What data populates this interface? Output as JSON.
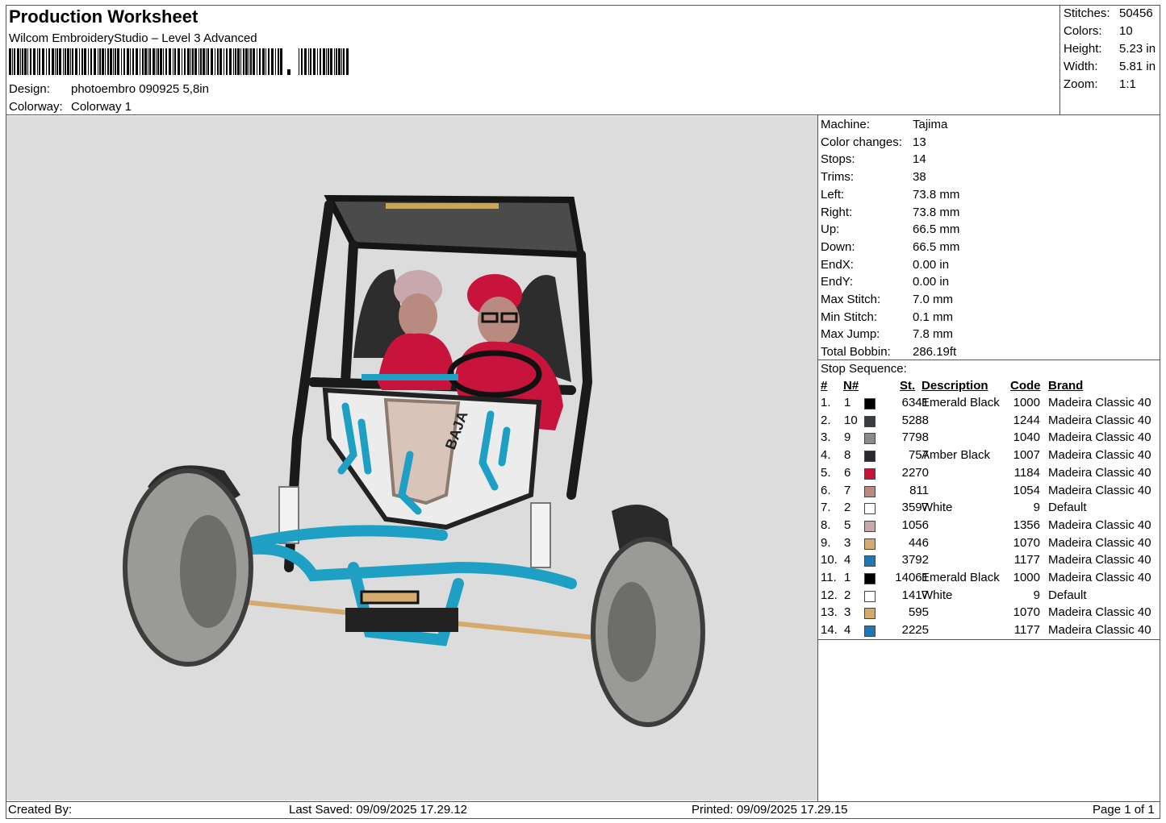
{
  "header": {
    "title": "Production Worksheet",
    "software": "Wilcom EmbroideryStudio – Level 3 Advanced",
    "design_label": "Design:",
    "design_value": "photoembro 090925 5,8in",
    "colorway_label": "Colorway:",
    "colorway_value": "Colorway 1"
  },
  "summary": [
    {
      "label": "Stitches:",
      "value": "50456"
    },
    {
      "label": "Colors:",
      "value": "10"
    },
    {
      "label": "Height:",
      "value": "5.23 in"
    },
    {
      "label": "Width:",
      "value": "5.81 in"
    },
    {
      "label": "Zoom:",
      "value": "1:1"
    }
  ],
  "machine_info": [
    {
      "label": "Machine:",
      "value": "Tajima"
    },
    {
      "label": "Color changes:",
      "value": "13"
    },
    {
      "label": "Stops:",
      "value": "14"
    },
    {
      "label": "Trims:",
      "value": "38"
    },
    {
      "label": "Left:",
      "value": "73.8 mm"
    },
    {
      "label": "Right:",
      "value": "73.8 mm"
    },
    {
      "label": "Up:",
      "value": "66.5 mm"
    },
    {
      "label": "Down:",
      "value": "66.5 mm"
    },
    {
      "label": "EndX:",
      "value": "0.00 in"
    },
    {
      "label": "EndY:",
      "value": "0.00 in"
    },
    {
      "label": "Max Stitch:",
      "value": "7.0 mm"
    },
    {
      "label": "Min Stitch:",
      "value": "0.1 mm"
    },
    {
      "label": "Max Jump:",
      "value": "7.8 mm"
    },
    {
      "label": "Total Bobbin:",
      "value": "286.19ft"
    }
  ],
  "stop_sequence": {
    "title": "Stop Sequence:",
    "headers": {
      "index": "#",
      "needle": "N#",
      "stitches": "St.",
      "description": "Description",
      "code": "Code",
      "brand": "Brand"
    },
    "rows": [
      {
        "index": "1.",
        "needle": "1",
        "color": "#000000",
        "stitches": "6341",
        "description": "Emerald Black",
        "code": "1000",
        "brand": "Madeira Classic 40"
      },
      {
        "index": "2.",
        "needle": "10",
        "color": "#3a3c44",
        "stitches": "5288",
        "description": "",
        "code": "1244",
        "brand": "Madeira Classic 40"
      },
      {
        "index": "3.",
        "needle": "9",
        "color": "#8a8a8a",
        "stitches": "7798",
        "description": "",
        "code": "1040",
        "brand": "Madeira Classic 40"
      },
      {
        "index": "4.",
        "needle": "8",
        "color": "#2a2a2e",
        "stitches": "757",
        "description": "Amber Black",
        "code": "1007",
        "brand": "Madeira Classic 40"
      },
      {
        "index": "5.",
        "needle": "6",
        "color": "#c8143c",
        "stitches": "2270",
        "description": "",
        "code": "1184",
        "brand": "Madeira Classic 40"
      },
      {
        "index": "6.",
        "needle": "7",
        "color": "#b88a80",
        "stitches": "811",
        "description": "",
        "code": "1054",
        "brand": "Madeira Classic 40"
      },
      {
        "index": "7.",
        "needle": "2",
        "color": "#ffffff",
        "stitches": "3597",
        "description": "White",
        "code": "9",
        "brand": "Default"
      },
      {
        "index": "8.",
        "needle": "5",
        "color": "#c8a8ac",
        "stitches": "1056",
        "description": "",
        "code": "1356",
        "brand": "Madeira Classic 40"
      },
      {
        "index": "9.",
        "needle": "3",
        "color": "#d4aa6e",
        "stitches": "446",
        "description": "",
        "code": "1070",
        "brand": "Madeira Classic 40"
      },
      {
        "index": "10.",
        "needle": "4",
        "color": "#1e78b4",
        "stitches": "3792",
        "description": "",
        "code": "1177",
        "brand": "Madeira Classic 40"
      },
      {
        "index": "11.",
        "needle": "1",
        "color": "#000000",
        "stitches": "14061",
        "description": "Emerald Black",
        "code": "1000",
        "brand": "Madeira Classic 40"
      },
      {
        "index": "12.",
        "needle": "2",
        "color": "#ffffff",
        "stitches": "1417",
        "description": "White",
        "code": "9",
        "brand": "Default"
      },
      {
        "index": "13.",
        "needle": "3",
        "color": "#d4aa6e",
        "stitches": "595",
        "description": "",
        "code": "1070",
        "brand": "Madeira Classic 40"
      },
      {
        "index": "14.",
        "needle": "4",
        "color": "#1e78b4",
        "stitches": "2225",
        "description": "",
        "code": "1177",
        "brand": "Madeira Classic 40"
      }
    ]
  },
  "preview": {
    "subject": "embroidered buggy with two riders",
    "panel_text": "BAJA",
    "background": "#dcdcdc"
  },
  "footer": {
    "created_by": "Created By:",
    "last_saved": "Last Saved: 09/09/2025 17.29.12",
    "printed": "Printed: 09/09/2025 17.29.15",
    "page": "Page 1 of 1"
  }
}
